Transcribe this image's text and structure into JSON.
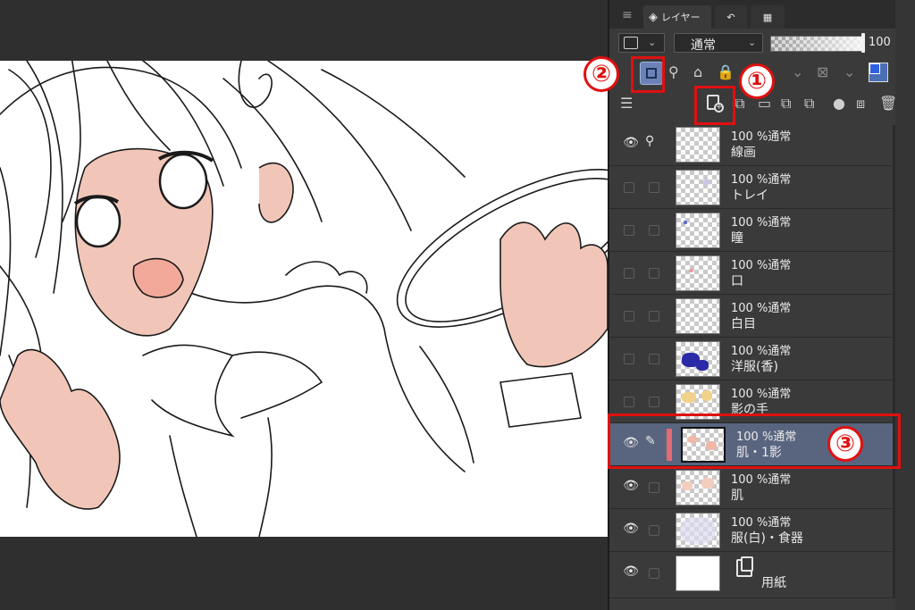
{
  "panel": {
    "tab_layer_label": "レイヤー",
    "blend_mode": "通常",
    "opacity": "100",
    "icons": {
      "menu": "menu-icon",
      "layer_tab": "layers-icon",
      "history_tab": "undo-history-icon",
      "animation_tab": "timeline-icon",
      "reference_layer": "reference-layer-icon",
      "new_raster_layer": "new-raster-layer-icon",
      "color_swatch_main": "#2f61e0",
      "color_swatch_sub": "#4b6fb5"
    }
  },
  "layers": [
    {
      "mode": "100 %通常",
      "name": "線画",
      "visible": true,
      "icon": "lightbulb-icon"
    },
    {
      "mode": "100 %通常",
      "name": "トレイ",
      "visible": false
    },
    {
      "mode": "100 %通常",
      "name": "瞳",
      "visible": false
    },
    {
      "mode": "100 %通常",
      "name": "口",
      "visible": false
    },
    {
      "mode": "100 %通常",
      "name": "白目",
      "visible": false
    },
    {
      "mode": "100 %通常",
      "name": "洋服(香)",
      "visible": false
    },
    {
      "mode": "100 %通常",
      "name": "影の手",
      "visible": false
    },
    {
      "mode": "100 %通常",
      "name": "肌・1影",
      "visible": true,
      "selected": true,
      "icon": "pen-icon"
    },
    {
      "mode": "100 %通常",
      "name": "肌",
      "visible": true
    },
    {
      "mode": "100 %通常",
      "name": "服(白)・食器",
      "visible": true
    },
    {
      "mode": "",
      "name": "用紙",
      "visible": true,
      "paper": true
    }
  ],
  "annotations": {
    "one": "①",
    "two": "②",
    "three": "③",
    "color": "#e01010"
  },
  "canvas": {
    "skin_color": "#f1c6b8",
    "line_color": "#1a1a1a"
  }
}
